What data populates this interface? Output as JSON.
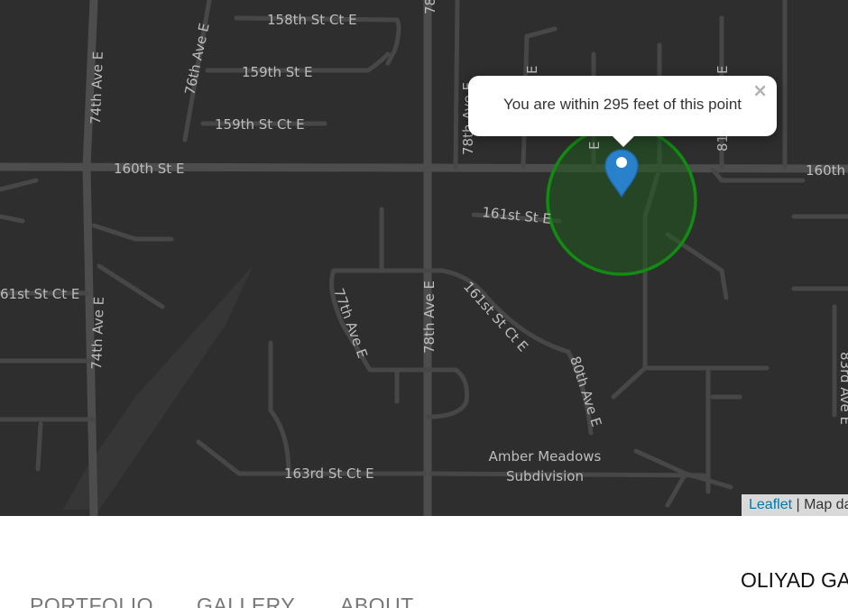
{
  "map": {
    "streets": {
      "s158": "158th St Ct E",
      "s159": "159th St E",
      "s159ct": "159th St Ct E",
      "s160": "160th St E",
      "s160b": "160th",
      "s161": "161st St E",
      "s161ct_left": "61st St Ct E",
      "s161ct": "161st St Ct E",
      "s163ct": "163rd St Ct E",
      "a74": "74th Ave E",
      "a74b": "74th Ave E",
      "a76": "76th Ave E",
      "a77": "77th Ave E",
      "a78": "78th Ave E",
      "a78top": "78",
      "a78b": "78th Ave E",
      "a80": "80th Ave E",
      "a81": "81",
      "a83": "83rd Ave E",
      "e1": "E",
      "e2": "E",
      "e3": "E"
    },
    "area_label_line1": "Amber Meadows",
    "area_label_line2": "Subdivision",
    "circle_color": "#1f7a1f",
    "marker_color": "#2a81cb",
    "marker_icon": "map-pin-icon"
  },
  "popup": {
    "text": "You are within 295 feet of this point",
    "close_label": "×"
  },
  "attribution": {
    "leaflet": "Leaflet",
    "separator": " | ",
    "rest": "Map da"
  },
  "site": {
    "brand": "OLIYAD GA",
    "nav": [
      "PORTFOLIO",
      "GALLERY",
      "ABOUT"
    ]
  }
}
